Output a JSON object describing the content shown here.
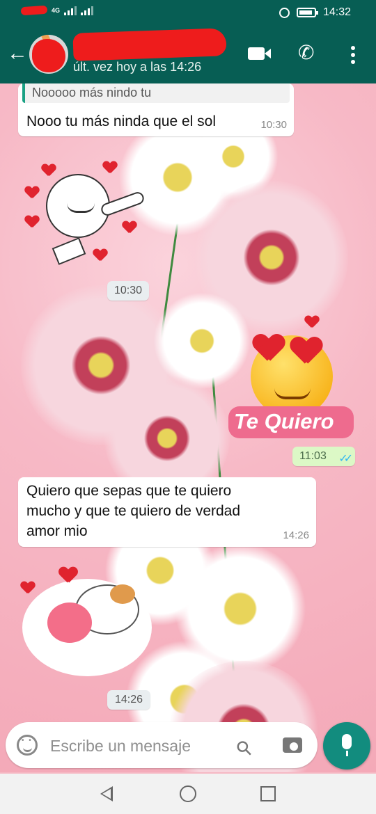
{
  "status_bar": {
    "network": "4G",
    "time": "14:32"
  },
  "header": {
    "last_seen": "últ. vez hoy a las 14:26"
  },
  "messages": [
    {
      "type": "incoming",
      "quote": "Nooooo más nindo tu",
      "text": "Nooo tu más ninda que el sol",
      "time": "10:30"
    },
    {
      "type": "incoming-sticker",
      "time": "10:30"
    },
    {
      "type": "outgoing-sticker",
      "sticker_text": "Te Quiero",
      "time": "11:03"
    },
    {
      "type": "incoming",
      "lines": [
        "Quiero que sepas que te quiero",
        "mucho y que te quiero de verdad",
        "amor mio"
      ],
      "time": "14:26"
    },
    {
      "type": "incoming-sticker",
      "time": "14:26"
    }
  ],
  "composer": {
    "placeholder": "Escribe un mensaje"
  },
  "colors": {
    "header": "#075e54",
    "outgoing": "#dcf8c6",
    "accent": "#128c7e",
    "read_ticks": "#34b7f1"
  }
}
